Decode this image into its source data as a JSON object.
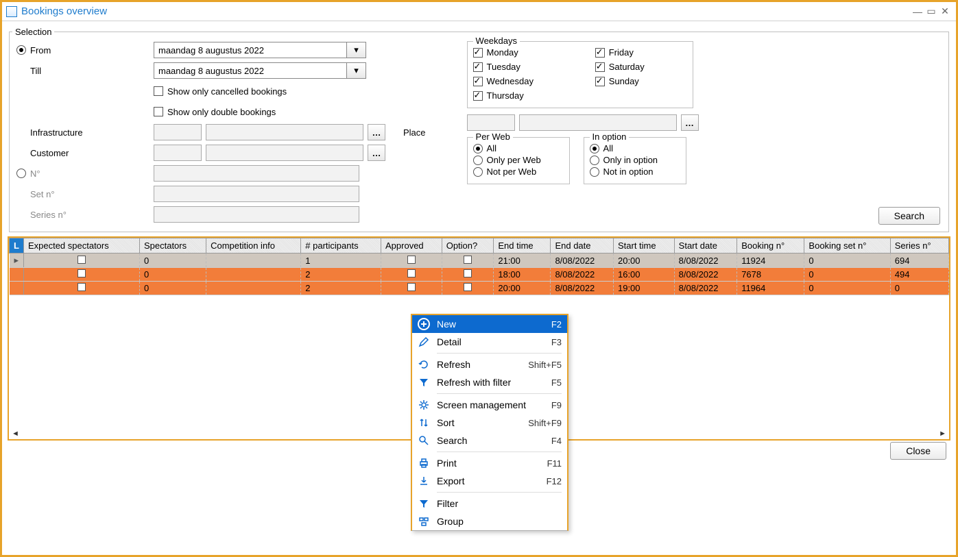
{
  "title": "Bookings overview",
  "selection": {
    "legend": "Selection",
    "from_label": "From",
    "from_value": "maandag 8 augustus 2022",
    "till_label": "Till",
    "till_value": "maandag 8 augustus 2022",
    "chk_cancelled": "Show only cancelled bookings",
    "chk_double": "Show only double bookings",
    "infrastructure_label": "Infrastructure",
    "customer_label": "Customer",
    "n_label": "N°",
    "setn_label": "Set n°",
    "seriesn_label": "Series n°",
    "place_label": "Place",
    "weekdays_title": "Weekdays",
    "weekdays": [
      "Monday",
      "Tuesday",
      "Wednesday",
      "Thursday",
      "Friday",
      "Saturday",
      "Sunday"
    ],
    "perweb_title": "Per Web",
    "perweb_opts": [
      "All",
      "Only per Web",
      "Not per Web"
    ],
    "inoption_title": "In option",
    "inoption_opts": [
      "All",
      "Only in option",
      "Not in option"
    ],
    "search_btn": "Search"
  },
  "table": {
    "headers": [
      "Expected spectators",
      "Spectators",
      "Competition info",
      "# participants",
      "Approved",
      "Option?",
      "End time",
      "End date",
      "Start time",
      "Start date",
      "Booking n°",
      "Booking set n°",
      "Series n°"
    ],
    "rows": [
      {
        "sel": true,
        "orange": false,
        "exp_spec_chk": false,
        "spectators": "0",
        "comp": "",
        "participants": "1",
        "approved_chk": false,
        "option_chk": false,
        "end_time": "21:00",
        "end_date": "8/08/2022",
        "start_time": "20:00",
        "start_date": "8/08/2022",
        "booking_n": "11924",
        "set_n": "0",
        "series_n": "694"
      },
      {
        "sel": false,
        "orange": true,
        "exp_spec_chk": false,
        "spectators": "0",
        "comp": "",
        "participants": "2",
        "approved_chk": false,
        "option_chk": false,
        "end_time": "18:00",
        "end_date": "8/08/2022",
        "start_time": "16:00",
        "start_date": "8/08/2022",
        "booking_n": "7678",
        "set_n": "0",
        "series_n": "494"
      },
      {
        "sel": false,
        "orange": true,
        "exp_spec_chk": false,
        "spectators": "0",
        "comp": "",
        "participants": "2",
        "approved_chk": false,
        "option_chk": false,
        "end_time": "20:00",
        "end_date": "8/08/2022",
        "start_time": "19:00",
        "start_date": "8/08/2022",
        "booking_n": "11964",
        "set_n": "0",
        "series_n": "0"
      }
    ]
  },
  "context_menu": [
    {
      "icon": "plus",
      "label": "New",
      "shortcut": "F2",
      "selected": true
    },
    {
      "icon": "pencil",
      "label": "Detail",
      "shortcut": "F3"
    },
    {
      "sep": true
    },
    {
      "icon": "refresh",
      "label": "Refresh",
      "shortcut": "Shift+F5"
    },
    {
      "icon": "refresh-filter",
      "label": "Refresh with filter",
      "shortcut": "F5"
    },
    {
      "sep": true
    },
    {
      "icon": "gear",
      "label": "Screen management",
      "shortcut": "F9"
    },
    {
      "icon": "sort",
      "label": "Sort",
      "shortcut": "Shift+F9"
    },
    {
      "icon": "search",
      "label": "Search",
      "shortcut": "F4"
    },
    {
      "sep": true
    },
    {
      "icon": "print",
      "label": "Print",
      "shortcut": "F11"
    },
    {
      "icon": "export",
      "label": "Export",
      "shortcut": "F12"
    },
    {
      "sep": true
    },
    {
      "icon": "filter",
      "label": "Filter",
      "shortcut": ""
    },
    {
      "icon": "group",
      "label": "Group",
      "shortcut": ""
    }
  ],
  "close_btn": "Close"
}
